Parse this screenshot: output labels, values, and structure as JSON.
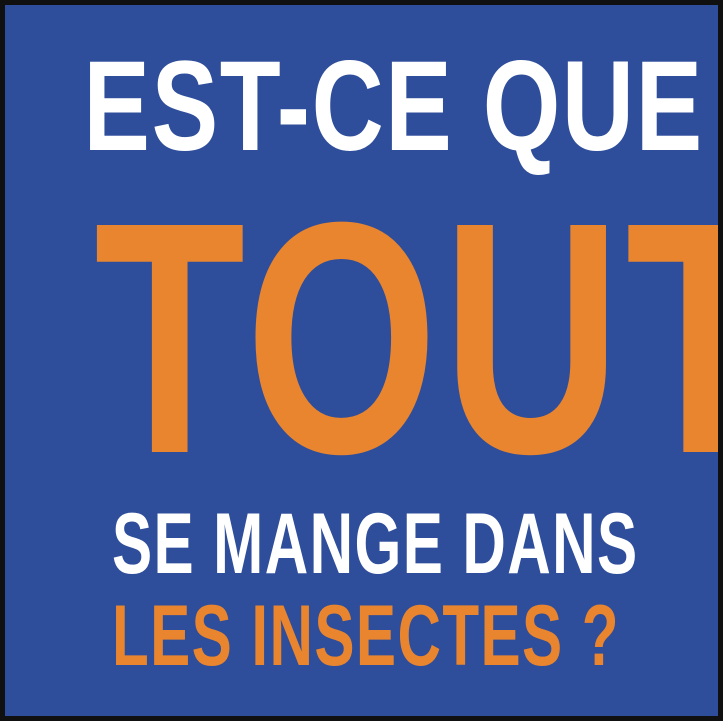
{
  "colors": {
    "background": "#2e4d9a",
    "white_text": "#ffffff",
    "accent_text": "#e8852e",
    "frame": "#101010"
  },
  "headline": {
    "line1": "EST-CE QUE",
    "line2": "TOUT",
    "line3": "SE MANGE DANS",
    "line4": "LES INSECTES ?"
  }
}
